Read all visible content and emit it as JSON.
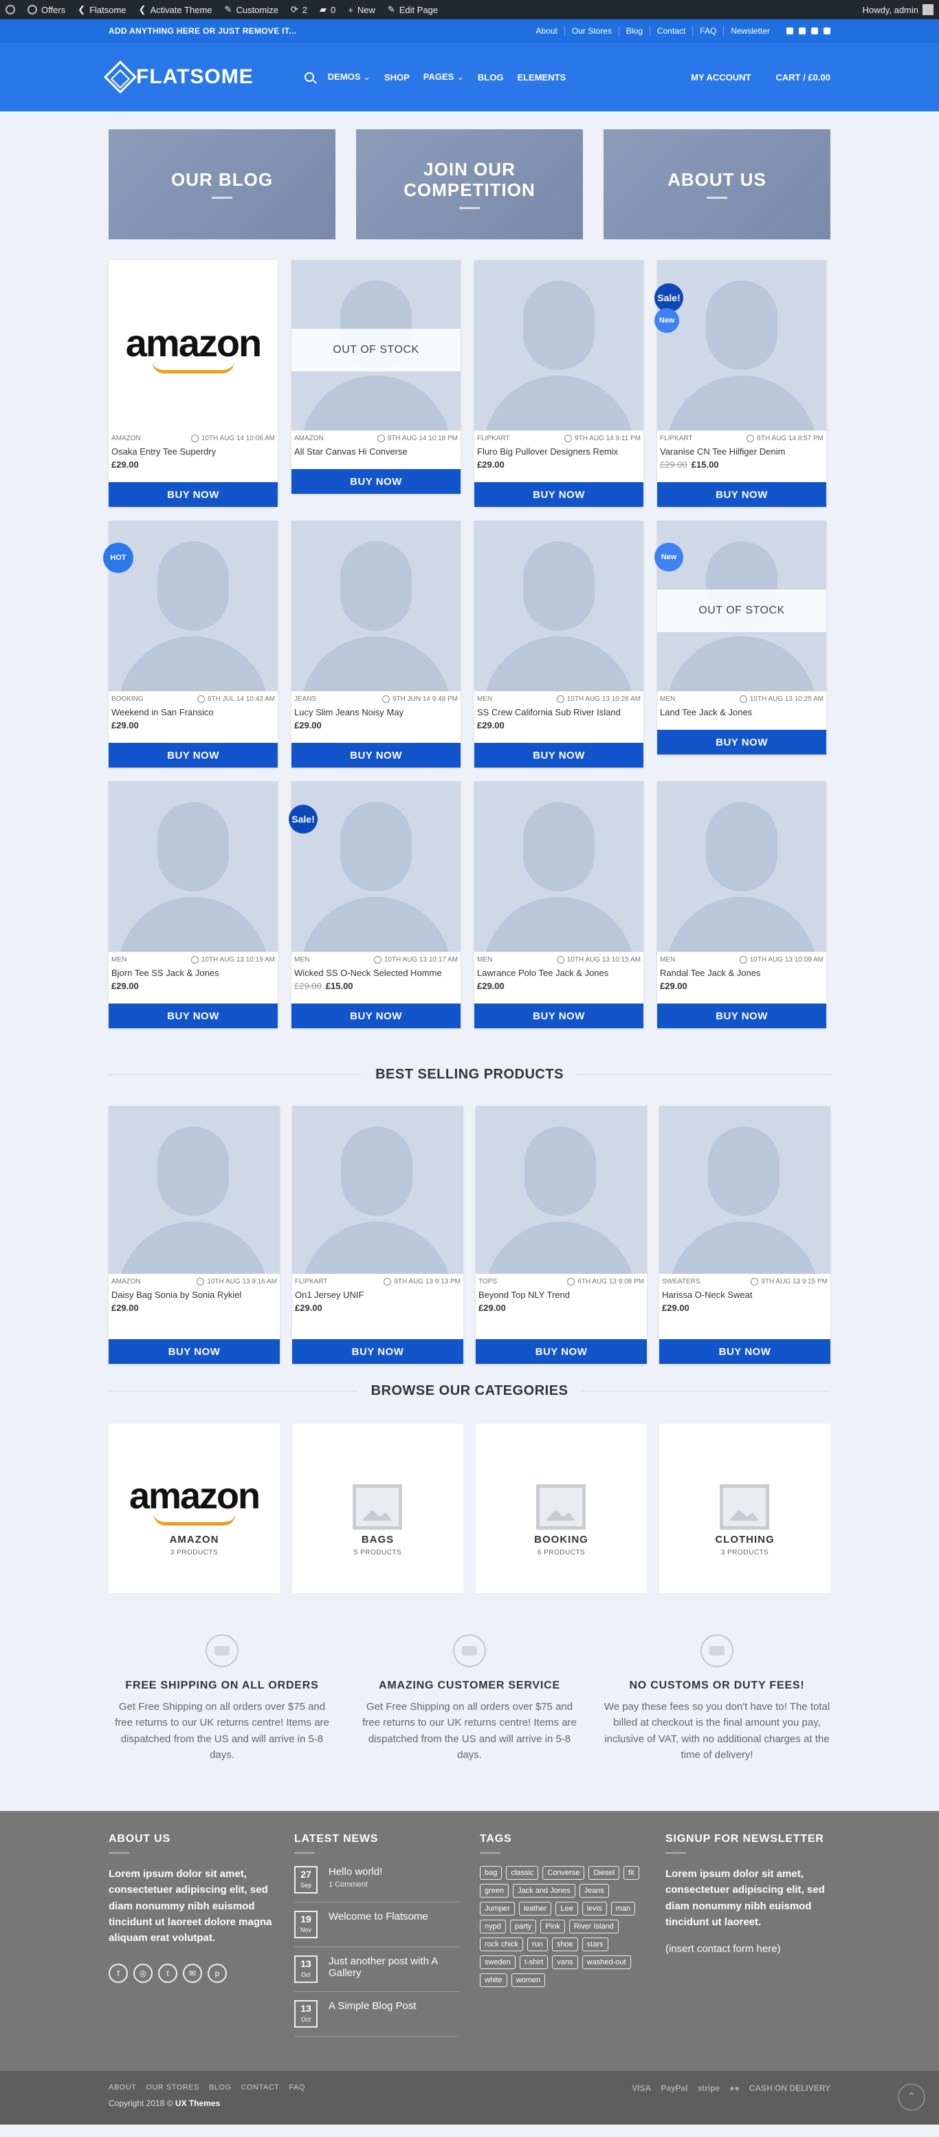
{
  "adminbar": {
    "items": [
      "Offers",
      "Flatsome",
      "Activate Theme",
      "Customize",
      "2",
      "0",
      "New",
      "Edit Page"
    ],
    "howdy": "Howdy, admin"
  },
  "topbar": {
    "message": "ADD ANYTHING HERE OR JUST REMOVE IT...",
    "links": [
      "About",
      "Our Stores",
      "Blog",
      "Contact",
      "FAQ",
      "Newsletter"
    ]
  },
  "header": {
    "logo": "FLATSOME",
    "nav": [
      "DEMOS",
      "SHOP",
      "PAGES",
      "BLOG",
      "ELEMENTS"
    ],
    "account": "MY ACCOUNT",
    "cart": "CART / £0.00"
  },
  "banners": [
    "OUR BLOG",
    "JOIN OUR COMPETITION",
    "ABOUT US"
  ],
  "products": [
    {
      "cat": "AMAZON",
      "date": "10TH AUG 14 10:06 AM",
      "name": "Osaka Entry Tee Superdry",
      "price": "£29.00",
      "old": "",
      "img": "amazon",
      "oos": false,
      "badge": ""
    },
    {
      "cat": "AMAZON",
      "date": "9TH AUG 14 10:18 PM",
      "name": "All Star Canvas Hi Converse",
      "price": "",
      "old": "",
      "img": "person",
      "oos": true,
      "badge": ""
    },
    {
      "cat": "FLIPKART",
      "date": "9TH AUG 14 9:11 PM",
      "name": "Fluro Big Pullover Designers Remix",
      "price": "£29.00",
      "old": "",
      "img": "person",
      "oos": false,
      "badge": ""
    },
    {
      "cat": "FLIPKART",
      "date": "8TH AUG 14 8:57 PM",
      "name": "Varanise CN Tee Hilfiger Denim",
      "price": "£15.00",
      "old": "£29.00",
      "img": "person",
      "oos": false,
      "badge": "salenew"
    },
    {
      "cat": "BOOKING",
      "date": "6TH JUL 14 10:43 AM",
      "name": "Weekend in San Fransico",
      "price": "£29.00",
      "old": "",
      "img": "person",
      "oos": false,
      "badge": "hot"
    },
    {
      "cat": "JEANS",
      "date": "9TH JUN 14 9:48 PM",
      "name": "Lucy Slim Jeans Noisy May",
      "price": "£29.00",
      "old": "",
      "img": "person",
      "oos": false,
      "badge": ""
    },
    {
      "cat": "MEN",
      "date": "10TH AUG 13 10:26 AM",
      "name": "SS Crew California Sub River Island",
      "price": "£29.00",
      "old": "",
      "img": "person",
      "oos": false,
      "badge": ""
    },
    {
      "cat": "MEN",
      "date": "10TH AUG 13 10:25 AM",
      "name": "Land Tee Jack & Jones",
      "price": "",
      "old": "",
      "img": "person",
      "oos": true,
      "badge": "new"
    },
    {
      "cat": "MEN",
      "date": "10TH AUG 13 10:19 AM",
      "name": "Bjorn Tee SS Jack & Jones",
      "price": "£29.00",
      "old": "",
      "img": "person",
      "oos": false,
      "badge": ""
    },
    {
      "cat": "MEN",
      "date": "10TH AUG 13 10:17 AM",
      "name": "Wicked SS O-Neck Selected Homme",
      "price": "£15.00",
      "old": "£29.00",
      "img": "person",
      "oos": false,
      "badge": "sale"
    },
    {
      "cat": "MEN",
      "date": "10TH AUG 13 10:15 AM",
      "name": "Lawrance Polo Tee Jack & Jones",
      "price": "£29.00",
      "old": "",
      "img": "person",
      "oos": false,
      "badge": ""
    },
    {
      "cat": "MEN",
      "date": "10TH AUG 13 10:09 AM",
      "name": "Randal Tee Jack & Jones",
      "price": "£29.00",
      "old": "",
      "img": "person",
      "oos": false,
      "badge": ""
    }
  ],
  "buy_label": "BUY NOW",
  "out_of_stock": "OUT OF STOCK",
  "labels": {
    "sale": "Sale!",
    "new": "New",
    "hot": "HOT"
  },
  "best_selling": {
    "title": "BEST SELLING PRODUCTS",
    "items": [
      {
        "cat": "AMAZON",
        "date": "10TH AUG 13 9:16 AM",
        "name": "Daisy Bag Sonia by Sonia Rykiel",
        "price": "£29.00"
      },
      {
        "cat": "FLIPKART",
        "date": "9TH AUG 13 9:13 PM",
        "name": "On1 Jersey UNIF",
        "price": "£29.00"
      },
      {
        "cat": "TOPS",
        "date": "6TH AUG 13 9:08 PM",
        "name": "Beyond Top NLY Trend",
        "price": "£29.00"
      },
      {
        "cat": "SWEATERS",
        "date": "9TH AUG 13 9:15 PM",
        "name": "Harissa O-Neck Sweat",
        "price": "£29.00"
      }
    ]
  },
  "categories": {
    "title": "BROWSE OUR CATEGORIES",
    "items": [
      {
        "name": "AMAZON",
        "count": "3 PRODUCTS",
        "img": "amazon"
      },
      {
        "name": "BAGS",
        "count": "5 PRODUCTS",
        "img": "placeholder"
      },
      {
        "name": "BOOKING",
        "count": "6 PRODUCTS",
        "img": "placeholder"
      },
      {
        "name": "CLOTHING",
        "count": "3 PRODUCTS",
        "img": "placeholder"
      }
    ]
  },
  "features": [
    {
      "title": "FREE SHIPPING ON ALL ORDERS",
      "text": "Get Free Shipping on all orders over $75 and free returns to our UK returns centre! Items are dispatched from the US and will arrive in 5-8 days."
    },
    {
      "title": "AMAZING CUSTOMER SERVICE",
      "text": "Get Free Shipping on all orders over $75 and free returns to our UK returns centre! Items are dispatched from the US and will arrive in 5-8 days."
    },
    {
      "title": "NO CUSTOMS OR DUTY FEES!",
      "text": "We pay these fees so you don't have to! The total billed at checkout is the final amount you pay, inclusive of VAT, with no additional charges at the time of delivery!"
    }
  ],
  "footer": {
    "about_title": "ABOUT US",
    "about_text": "Lorem ipsum dolor sit amet, consectetuer adipiscing elit, sed diam nonummy nibh euismod tincidunt ut laoreet dolore magna aliquam erat volutpat.",
    "news_title": "LATEST NEWS",
    "news": [
      {
        "day": "27",
        "mon": "Sep",
        "title": "Hello world!",
        "sub": "1 Comment"
      },
      {
        "day": "19",
        "mon": "Nov",
        "title": "Welcome to Flatsome",
        "sub": ""
      },
      {
        "day": "13",
        "mon": "Oct",
        "title": "Just another post with A Gallery",
        "sub": ""
      },
      {
        "day": "13",
        "mon": "Oct",
        "title": "A Simple Blog Post",
        "sub": ""
      }
    ],
    "tags_title": "TAGS",
    "tags": [
      "bag",
      "classic",
      "Converse",
      "Diesel",
      "fit",
      "green",
      "Jack and Jones",
      "Jeans",
      "Jumper",
      "leather",
      "Lee",
      "levis",
      "man",
      "nypd",
      "party",
      "Pink",
      "River Island",
      "rock chick",
      "run",
      "shoe",
      "stars",
      "sweden",
      "t-shirt",
      "vans",
      "washed-out",
      "white",
      "women"
    ],
    "newsletter_title": "SIGNUP FOR NEWSLETTER",
    "newsletter_text": "Lorem ipsum dolor sit amet, consectetuer adipiscing elit, sed diam nonummy nibh euismod tincidunt ut laoreet.",
    "newsletter_note": "(insert contact form here)",
    "links": [
      "ABOUT",
      "OUR STORES",
      "BLOG",
      "CONTACT",
      "FAQ"
    ],
    "copyright_prefix": "Copyright 2018 ©",
    "copyright_brand": "UX Themes",
    "payments": [
      "VISA",
      "PayPal",
      "stripe",
      "●●",
      "CASH ON DELIVERY"
    ]
  }
}
